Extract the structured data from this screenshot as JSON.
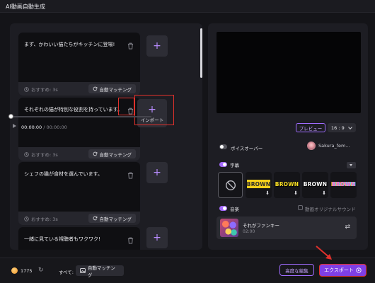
{
  "window": {
    "title": "AI動画自動生成"
  },
  "scenes": [
    {
      "text": "まず、かわいい猫たちがキッチンに登場!",
      "recommend": "おすすめ: 3s",
      "automatch_label": "自動マッチング"
    },
    {
      "text": "それぞれの猫が特別な役割を持っています。",
      "recommend": "おすすめ: 3s",
      "automatch_label": "自動マッチング"
    },
    {
      "text": "シェフの猫が食材を選んでいます。",
      "recommend": "おすすめ: 3s",
      "automatch_label": "自動マッチング"
    },
    {
      "text": "一緒に見ている視聴者もワクワク!"
    }
  ],
  "import_label": "インポート",
  "player": {
    "time_current": "00:00:00",
    "time_total": "/ 00:00:00",
    "preview_label": "プレビュー",
    "aspect_ratio": "16 : 9"
  },
  "voiceover": {
    "label": "ボイスオーバー",
    "voice_name": "Sakura_fem..."
  },
  "subtitles": {
    "label": "字幕",
    "styles": [
      {
        "word": "BROWN",
        "color": "#2a2a2a",
        "bg": "#f6d11b"
      },
      {
        "word": "BROWN",
        "color": "#ffe326",
        "bg": "#141418"
      },
      {
        "word": "BROWN",
        "color": "#ffffff",
        "bg": "#141418"
      },
      {
        "word": "BROWN",
        "color": "#ff5cc8",
        "bg": "#141418"
      }
    ]
  },
  "music": {
    "label": "音楽",
    "original_sound_label": "動画オリジナルサウンド",
    "track_name": "それがファンキー",
    "track_duration": "02:00"
  },
  "bottom": {
    "credits": "1775",
    "all_label": "すべて:",
    "automatch_all_label": "自動マッチング",
    "advanced_edit_label": "高度な編集",
    "export_label": "エクスポート"
  },
  "colors": {
    "accent": "#a56bff",
    "export_bg": "#7f3fe6",
    "highlight_red": "#e0312c"
  }
}
